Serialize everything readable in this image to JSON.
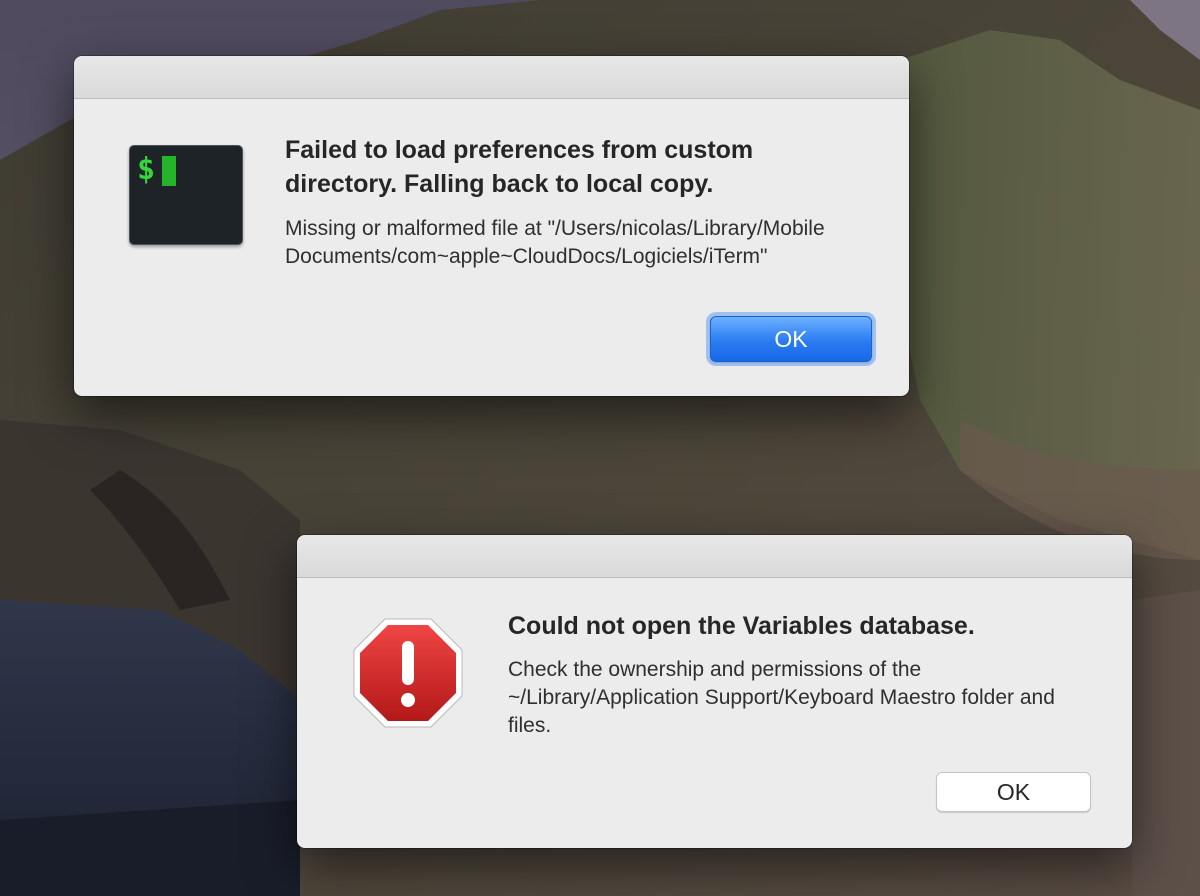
{
  "dialogs": {
    "iterm": {
      "title": "Failed to load preferences from custom directory. Falling back to local copy.",
      "message": "Missing or malformed file at \"/Users/nicolas/Library/Mobile Documents/com~apple~CloudDocs/Logiciels/iTerm\"",
      "icon": "terminal-icon",
      "ok_label": "OK",
      "default_button": true
    },
    "keyboard_maestro": {
      "title": "Could not open the Variables database.",
      "message": "Check the ownership and permissions of the ~/Library/Application Support/Keyboard Maestro folder and files.",
      "icon": "stop-icon",
      "ok_label": "OK",
      "default_button": false
    }
  },
  "colors": {
    "dialog_background": "#ececec",
    "default_button_blue": "#2b7cf2",
    "prompt_green": "#33d63c",
    "stop_red": "#d42a2a"
  }
}
